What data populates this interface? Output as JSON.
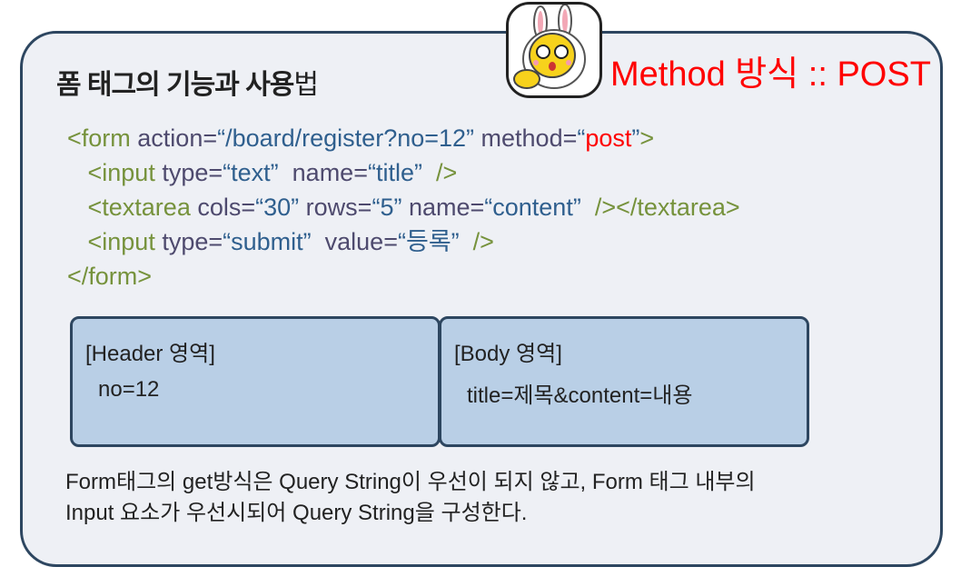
{
  "title": {
    "bold": "폼 태그의 기능과 사용",
    "thin": "법"
  },
  "method_label": "Method 방식 :: POST",
  "code_lines": [
    [
      [
        "tag",
        "<form "
      ],
      [
        "attr",
        "action="
      ],
      [
        "val",
        "“/board/register?no=12” "
      ],
      [
        "attr",
        "method="
      ],
      [
        "val",
        "“"
      ],
      [
        "red",
        "post"
      ],
      [
        "val",
        "”"
      ],
      [
        "tag",
        ">"
      ]
    ],
    [
      [
        "tag",
        "   <input "
      ],
      [
        "attr",
        "type="
      ],
      [
        "val",
        "“text”  "
      ],
      [
        "attr",
        "name="
      ],
      [
        "val",
        "“title”  "
      ],
      [
        "tag",
        "/>"
      ]
    ],
    [
      [
        "tag",
        "   <textarea "
      ],
      [
        "attr",
        "cols="
      ],
      [
        "val",
        "“30” "
      ],
      [
        "attr",
        "rows="
      ],
      [
        "val",
        "“5” "
      ],
      [
        "attr",
        "name="
      ],
      [
        "val",
        "“content”  "
      ],
      [
        "tag",
        "/></textarea>"
      ]
    ],
    [
      [
        "tag",
        "   <input "
      ],
      [
        "attr",
        "type="
      ],
      [
        "val",
        "“submit”  "
      ],
      [
        "attr",
        "value="
      ],
      [
        "val",
        "“등록”  "
      ],
      [
        "tag",
        "/>"
      ]
    ],
    [
      [
        "tag",
        "</form>"
      ]
    ]
  ],
  "header_box": {
    "heading": "[Header 영역]",
    "value": "no=12"
  },
  "body_box": {
    "heading": "[Body 영역]",
    "value": "title=제목&content=내용"
  },
  "note": {
    "line1": "Form태그의 get방식은 Query String이 우선이 되지 않고, Form 태그 내부의",
    "line2": "Input 요소가 우선시되어 Query String을 구성한다."
  }
}
